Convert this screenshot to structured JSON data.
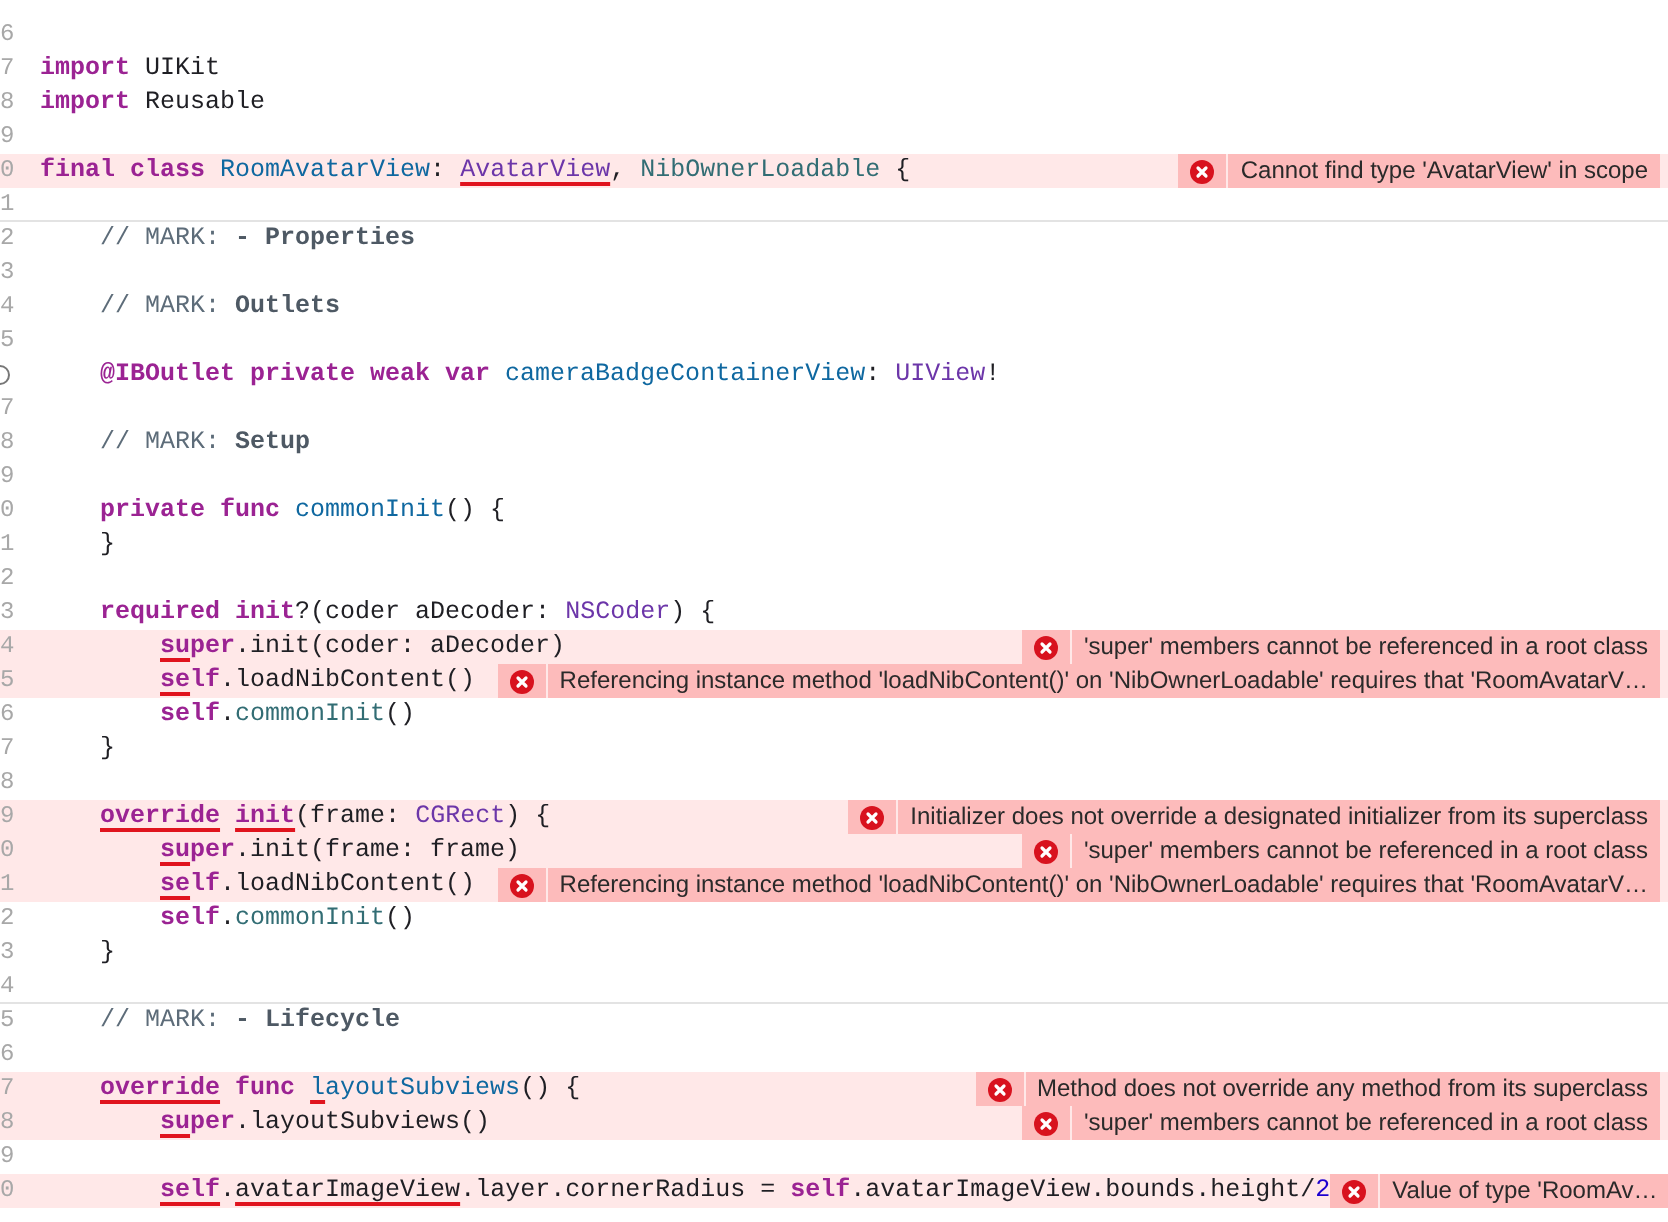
{
  "editor": {
    "lines": [
      {
        "gutter": {
          "kind": "number",
          "text": "6"
        },
        "error": false,
        "separator": false
      },
      {
        "gutter": {
          "kind": "number",
          "text": "7"
        },
        "error": false,
        "separator": false,
        "kind": "top",
        "tokens": [
          {
            "kind": "kw",
            "text": "import",
            "underlined": false
          },
          {
            "kind": "plain",
            "text": " UIKit",
            "underlined": false
          }
        ]
      },
      {
        "gutter": {
          "kind": "number",
          "text": "8"
        },
        "error": false,
        "separator": false,
        "kind": "top",
        "tokens": [
          {
            "kind": "kw",
            "text": "import",
            "underlined": false
          },
          {
            "kind": "plain",
            "text": " Reusable",
            "underlined": false
          }
        ]
      },
      {
        "gutter": {
          "kind": "number",
          "text": "9"
        },
        "error": false,
        "separator": false
      },
      {
        "gutter": {
          "kind": "number",
          "text": "0"
        },
        "error": true,
        "separator": false,
        "issue": "Cannot find type 'AvatarView' in scope",
        "kind": "top",
        "tokens": [
          {
            "kind": "kw",
            "text": "final class ",
            "underlined": false
          },
          {
            "kind": "decl",
            "text": "RoomAvatarView",
            "underlined": false
          },
          {
            "kind": "plain",
            "text": ": ",
            "underlined": false
          },
          {
            "kind": "type",
            "text": "AvatarView",
            "underlined": true
          },
          {
            "kind": "plain",
            "text": ", ",
            "underlined": false
          },
          {
            "kind": "ref",
            "text": "NibOwnerLoadable",
            "underlined": false
          },
          {
            "kind": "plain",
            "text": " {",
            "underlined": false
          }
        ]
      },
      {
        "gutter": {
          "kind": "number",
          "text": "1"
        },
        "error": false,
        "separator": false
      },
      {
        "gutter": {
          "kind": "number",
          "text": "2"
        },
        "error": false,
        "separator": true,
        "kind": "member",
        "tokens": [
          {
            "kind": "comment",
            "text": "// MARK: ",
            "underlined": false
          },
          {
            "kind": "mark",
            "text": "- Properties",
            "underlined": false
          }
        ]
      },
      {
        "gutter": {
          "kind": "number",
          "text": "3"
        },
        "error": false,
        "separator": false
      },
      {
        "gutter": {
          "kind": "number",
          "text": "4"
        },
        "error": false,
        "separator": false,
        "kind": "member",
        "tokens": [
          {
            "kind": "comment",
            "text": "// MARK: ",
            "underlined": false
          },
          {
            "kind": "mark",
            "text": "Outlets",
            "underlined": false
          }
        ]
      },
      {
        "gutter": {
          "kind": "number",
          "text": "5"
        },
        "error": false,
        "separator": false
      },
      {
        "gutter": {
          "kind": "outlet"
        },
        "error": false,
        "separator": false,
        "kind": "member",
        "tokens": [
          {
            "kind": "kw",
            "text": "@IBOutlet private weak var ",
            "underlined": false
          },
          {
            "kind": "decl",
            "text": "cameraBadgeContainerView",
            "underlined": false
          },
          {
            "kind": "plain",
            "text": ": ",
            "underlined": false
          },
          {
            "kind": "type",
            "text": "UIView",
            "underlined": false
          },
          {
            "kind": "plain",
            "text": "!",
            "underlined": false
          }
        ]
      },
      {
        "gutter": {
          "kind": "number",
          "text": "7"
        },
        "error": false,
        "separator": false
      },
      {
        "gutter": {
          "kind": "number",
          "text": "8"
        },
        "error": false,
        "separator": false,
        "kind": "member",
        "tokens": [
          {
            "kind": "comment",
            "text": "// MARK: ",
            "underlined": false
          },
          {
            "kind": "mark",
            "text": "Setup",
            "underlined": false
          }
        ]
      },
      {
        "gutter": {
          "kind": "number",
          "text": "9"
        },
        "error": false,
        "separator": false
      },
      {
        "gutter": {
          "kind": "number",
          "text": "0"
        },
        "error": false,
        "separator": false,
        "kind": "member",
        "tokens": [
          {
            "kind": "kw",
            "text": "private func ",
            "underlined": false
          },
          {
            "kind": "decl",
            "text": "commonInit",
            "underlined": false
          },
          {
            "kind": "plain",
            "text": "() {",
            "underlined": false
          }
        ]
      },
      {
        "gutter": {
          "kind": "number",
          "text": "1"
        },
        "error": false,
        "separator": false,
        "kind": "member",
        "tokens": [
          {
            "kind": "plain",
            "text": "}",
            "underlined": false
          }
        ]
      },
      {
        "gutter": {
          "kind": "number",
          "text": "2"
        },
        "error": false,
        "separator": false
      },
      {
        "gutter": {
          "kind": "number",
          "text": "3"
        },
        "error": false,
        "separator": false,
        "kind": "member",
        "tokens": [
          {
            "kind": "kw",
            "text": "required init",
            "underlined": false
          },
          {
            "kind": "plain",
            "text": "?(coder aDecoder: ",
            "underlined": false
          },
          {
            "kind": "type",
            "text": "NSCoder",
            "underlined": false
          },
          {
            "kind": "plain",
            "text": ") {",
            "underlined": false
          }
        ]
      },
      {
        "gutter": {
          "kind": "number",
          "text": "4"
        },
        "error": true,
        "separator": false,
        "issue": "'super' members cannot be referenced in a root class",
        "kind": "body",
        "tokens": [
          {
            "kind": "kw",
            "text": "su",
            "underlined": true
          },
          {
            "kind": "kw",
            "text": "per",
            "underlined": false
          },
          {
            "kind": "plain",
            "text": ".init(coder: aDecoder)",
            "underlined": false
          }
        ]
      },
      {
        "gutter": {
          "kind": "number",
          "text": "5"
        },
        "error": true,
        "separator": false,
        "issue": "Referencing instance method 'loadNibContent()' on 'NibOwnerLoadable' requires that 'RoomAvatarV…",
        "kind": "body",
        "tokens": [
          {
            "kind": "kw",
            "text": "se",
            "underlined": true
          },
          {
            "kind": "kw",
            "text": "lf",
            "underlined": false
          },
          {
            "kind": "plain",
            "text": ".loadNibContent()",
            "underlined": false
          }
        ]
      },
      {
        "gutter": {
          "kind": "number",
          "text": "6"
        },
        "error": false,
        "separator": false,
        "kind": "body",
        "tokens": [
          {
            "kind": "kw",
            "text": "self",
            "underlined": false
          },
          {
            "kind": "plain",
            "text": ".",
            "underlined": false
          },
          {
            "kind": "ref",
            "text": "commonInit",
            "underlined": false
          },
          {
            "kind": "plain",
            "text": "()",
            "underlined": false
          }
        ]
      },
      {
        "gutter": {
          "kind": "number",
          "text": "7"
        },
        "error": false,
        "separator": false,
        "kind": "member",
        "tokens": [
          {
            "kind": "plain",
            "text": "}",
            "underlined": false
          }
        ]
      },
      {
        "gutter": {
          "kind": "number",
          "text": "8"
        },
        "error": false,
        "separator": false
      },
      {
        "gutter": {
          "kind": "number",
          "text": "9"
        },
        "error": true,
        "separator": false,
        "issue": "Initializer does not override a designated initializer from its superclass",
        "kind": "member",
        "tokens": [
          {
            "kind": "kw",
            "text": "override",
            "underlined": true
          },
          {
            "kind": "kw",
            "text": " init",
            "underlined": true
          },
          {
            "kind": "plain",
            "text": "(frame: ",
            "underlined": false
          },
          {
            "kind": "type",
            "text": "CGRect",
            "underlined": false
          },
          {
            "kind": "plain",
            "text": ") {",
            "underlined": false
          }
        ]
      },
      {
        "gutter": {
          "kind": "number",
          "text": "0"
        },
        "error": true,
        "separator": false,
        "issue": "'super' members cannot be referenced in a root class",
        "kind": "body",
        "tokens": [
          {
            "kind": "kw",
            "text": "su",
            "underlined": true
          },
          {
            "kind": "kw",
            "text": "per",
            "underlined": false
          },
          {
            "kind": "plain",
            "text": ".init(frame: frame)",
            "underlined": false
          }
        ]
      },
      {
        "gutter": {
          "kind": "number",
          "text": "1"
        },
        "error": true,
        "separator": false,
        "issue": "Referencing instance method 'loadNibContent()' on 'NibOwnerLoadable' requires that 'RoomAvatarV…",
        "kind": "body",
        "tokens": [
          {
            "kind": "kw",
            "text": "se",
            "underlined": true
          },
          {
            "kind": "kw",
            "text": "lf",
            "underlined": false
          },
          {
            "kind": "plain",
            "text": ".loadNibContent()",
            "underlined": false
          }
        ]
      },
      {
        "gutter": {
          "kind": "number",
          "text": "2"
        },
        "error": false,
        "separator": false,
        "kind": "body",
        "tokens": [
          {
            "kind": "kw",
            "text": "self",
            "underlined": false
          },
          {
            "kind": "plain",
            "text": ".",
            "underlined": false
          },
          {
            "kind": "ref",
            "text": "commonInit",
            "underlined": false
          },
          {
            "kind": "plain",
            "text": "()",
            "underlined": false
          }
        ]
      },
      {
        "gutter": {
          "kind": "number",
          "text": "3"
        },
        "error": false,
        "separator": false,
        "kind": "member",
        "tokens": [
          {
            "kind": "plain",
            "text": "}",
            "underlined": false
          }
        ]
      },
      {
        "gutter": {
          "kind": "number",
          "text": "4"
        },
        "error": false,
        "separator": false
      },
      {
        "gutter": {
          "kind": "number",
          "text": "5"
        },
        "error": false,
        "separator": true,
        "kind": "member",
        "tokens": [
          {
            "kind": "comment",
            "text": "// MARK: ",
            "underlined": false
          },
          {
            "kind": "mark",
            "text": "- Lifecycle",
            "underlined": false
          }
        ]
      },
      {
        "gutter": {
          "kind": "number",
          "text": "6"
        },
        "error": false,
        "separator": false
      },
      {
        "gutter": {
          "kind": "number",
          "text": "7"
        },
        "error": true,
        "separator": false,
        "issue": "Method does not override any method from its superclass",
        "kind": "member",
        "tokens": [
          {
            "kind": "kw",
            "text": "override",
            "underlined": true
          },
          {
            "kind": "kw",
            "text": " func ",
            "underlined": false
          },
          {
            "kind": "decl",
            "text": "l",
            "underlined": true
          },
          {
            "kind": "decl",
            "text": "ayoutSubviews",
            "underlined": false
          },
          {
            "kind": "plain",
            "text": "() {",
            "underlined": false
          }
        ]
      },
      {
        "gutter": {
          "kind": "number",
          "text": "8"
        },
        "error": true,
        "separator": false,
        "issue": "'super' members cannot be referenced in a root class",
        "kind": "body",
        "tokens": [
          {
            "kind": "kw",
            "text": "su",
            "underlined": true
          },
          {
            "kind": "kw",
            "text": "per",
            "underlined": false
          },
          {
            "kind": "plain",
            "text": ".layoutSubviews()",
            "underlined": false
          }
        ]
      },
      {
        "gutter": {
          "kind": "number",
          "text": "9"
        },
        "error": false,
        "separator": false
      },
      {
        "gutter": {
          "kind": "number",
          "text": "0"
        },
        "error": true,
        "separator": false,
        "issue": "Value of type 'RoomAv…",
        "kind": "body",
        "tokens": [
          {
            "kind": "kw",
            "text": "self",
            "underlined": true
          },
          {
            "kind": "plain",
            "text": ".",
            "underlined": false
          },
          {
            "kind": "plain",
            "text": "avatarImageView",
            "underlined": true
          },
          {
            "kind": "plain",
            "text": ".layer.cornerRadius = ",
            "underlined": false
          },
          {
            "kind": "kw",
            "text": "self",
            "underlined": false
          },
          {
            "kind": "plain",
            "text": ".avatarImageView.bounds.height/",
            "underlined": false
          },
          {
            "kind": "num",
            "text": "2",
            "underlined": false
          }
        ]
      }
    ]
  }
}
